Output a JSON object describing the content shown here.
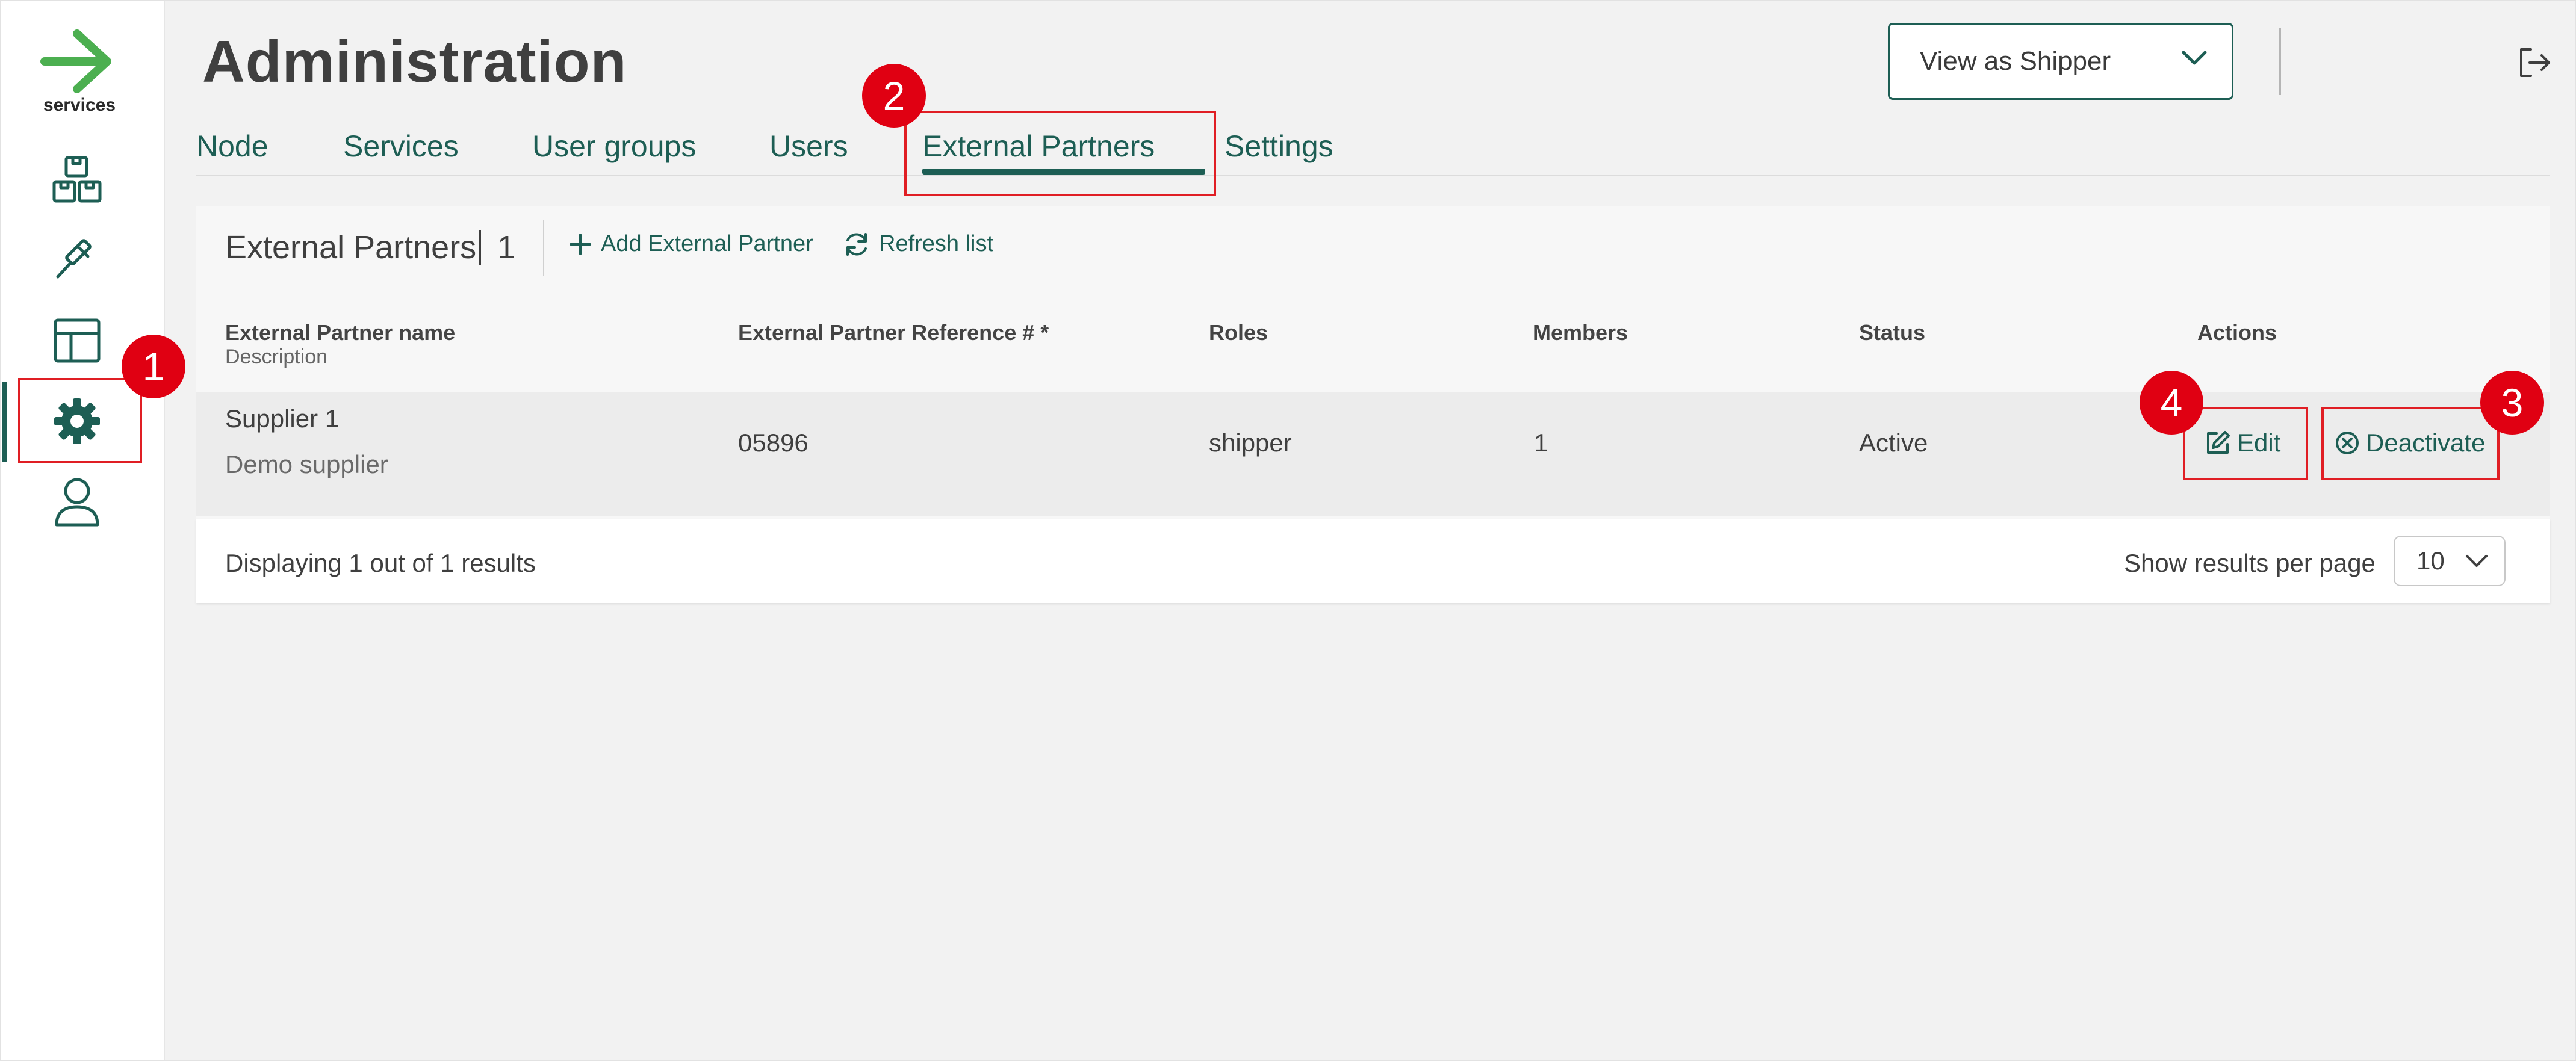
{
  "colors": {
    "accent": "#1d5e54",
    "logo_green": "#4caf50",
    "annotation_red": "#e00012"
  },
  "sidebar": {
    "logo_text": "services",
    "items": [
      {
        "icon": "boxes-icon"
      },
      {
        "icon": "gavel-icon"
      },
      {
        "icon": "layout-icon"
      },
      {
        "icon": "gear-icon",
        "active": true
      },
      {
        "icon": "user-icon"
      }
    ]
  },
  "header": {
    "title": "Administration",
    "view_select": {
      "value": "View as Shipper"
    },
    "logout_icon": "logout-icon"
  },
  "tabs": [
    {
      "label": "Node"
    },
    {
      "label": "Services"
    },
    {
      "label": "User groups"
    },
    {
      "label": "Users"
    },
    {
      "label": "External Partners",
      "active": true
    },
    {
      "label": "Settings"
    }
  ],
  "toolbar": {
    "title": "External Partners",
    "count": "1",
    "add_label": "Add External Partner",
    "refresh_label": "Refresh list"
  },
  "table": {
    "columns": {
      "name": "External Partner name",
      "name_sub": "Description",
      "reference": "External Partner Reference # *",
      "roles": "Roles",
      "members": "Members",
      "status": "Status",
      "actions": "Actions"
    },
    "rows": [
      {
        "name": "Supplier 1",
        "description": "Demo supplier",
        "reference": "05896",
        "roles": "shipper",
        "members": "1",
        "status": "Active",
        "edit_label": "Edit",
        "deactivate_label": "Deactivate"
      }
    ]
  },
  "footer": {
    "displaying": "Displaying 1 out of 1 results",
    "per_page_label": "Show results per page",
    "per_page_value": "10"
  },
  "annotations": [
    "1",
    "2",
    "3",
    "4"
  ]
}
